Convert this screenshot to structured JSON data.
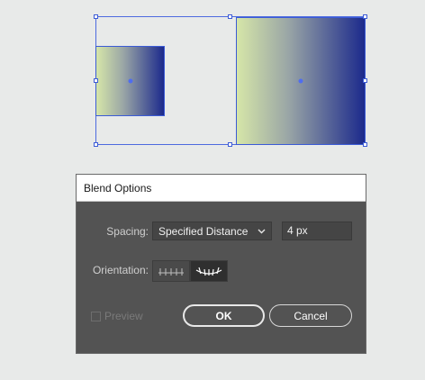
{
  "dialog": {
    "title": "Blend Options",
    "spacing_label": "Spacing:",
    "spacing_mode": "Specified Distance",
    "spacing_value": "4 px",
    "orientation_label": "Orientation:",
    "preview_label": "Preview",
    "ok_label": "OK",
    "cancel_label": "Cancel"
  },
  "canvas": {
    "small_square_gradient": [
      "#d6e6a8",
      "#1c2a8c"
    ],
    "large_square_gradient": [
      "#d6e6a8",
      "#1c2a8c"
    ],
    "selection_color": "#3b5bd6"
  },
  "icons": {
    "orient_align_page": "align-to-page-icon",
    "orient_align_path": "align-to-path-icon",
    "dropdown": "chevron-down-icon"
  }
}
